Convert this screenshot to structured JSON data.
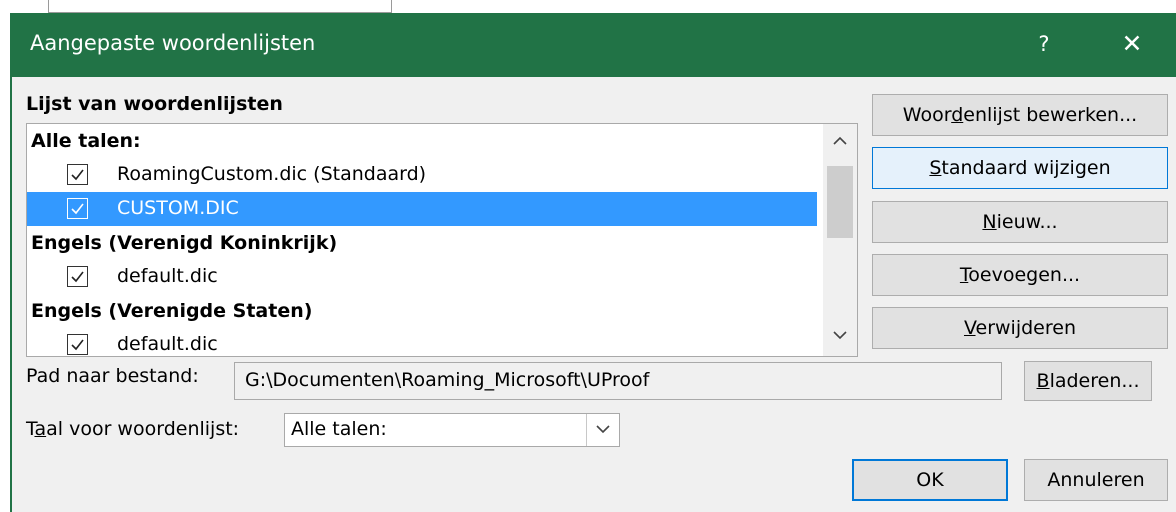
{
  "dialog": {
    "title": "Aangepaste woordenlijsten",
    "help_symbol": "?",
    "close_symbol": "✕"
  },
  "list": {
    "label": "Lijst van woordenlijsten",
    "rows": [
      {
        "type": "group",
        "text": "Alle talen:"
      },
      {
        "type": "item",
        "text": "RoamingCustom.dic (Standaard)",
        "checked": true,
        "selected": false
      },
      {
        "type": "item",
        "text": "CUSTOM.DIC",
        "checked": true,
        "selected": true
      },
      {
        "type": "group",
        "text": "Engels (Verenigd Koninkrijk)"
      },
      {
        "type": "item",
        "text": "default.dic",
        "checked": true,
        "selected": false
      },
      {
        "type": "group",
        "text": "Engels (Verenigde Staten)"
      },
      {
        "type": "item",
        "text": "default.dic",
        "checked": true,
        "selected": false
      }
    ],
    "scroll_up": "^",
    "scroll_down": "v"
  },
  "buttons": {
    "edit": {
      "pre": "Woor",
      "u": "d",
      "post": "enlijst bewerken..."
    },
    "change_default": {
      "pre": "",
      "u": "S",
      "post": "tandaard wijzigen"
    },
    "new": {
      "pre": "",
      "u": "N",
      "post": "ieuw..."
    },
    "add": {
      "pre": "",
      "u": "T",
      "post": "oevoegen..."
    },
    "remove": {
      "pre": "",
      "u": "V",
      "post": "erwijderen"
    },
    "browse": {
      "pre": "",
      "u": "B",
      "post": "laderen..."
    },
    "ok": "OK",
    "cancel": "Annuleren"
  },
  "path": {
    "label": "Pad naar bestand:",
    "value": "G:\\Documenten\\Roaming_Microsoft\\UProof"
  },
  "language": {
    "label_pre": "T",
    "label_u": "a",
    "label_post": "al voor woordenlijst:",
    "selected": "Alle talen:"
  }
}
